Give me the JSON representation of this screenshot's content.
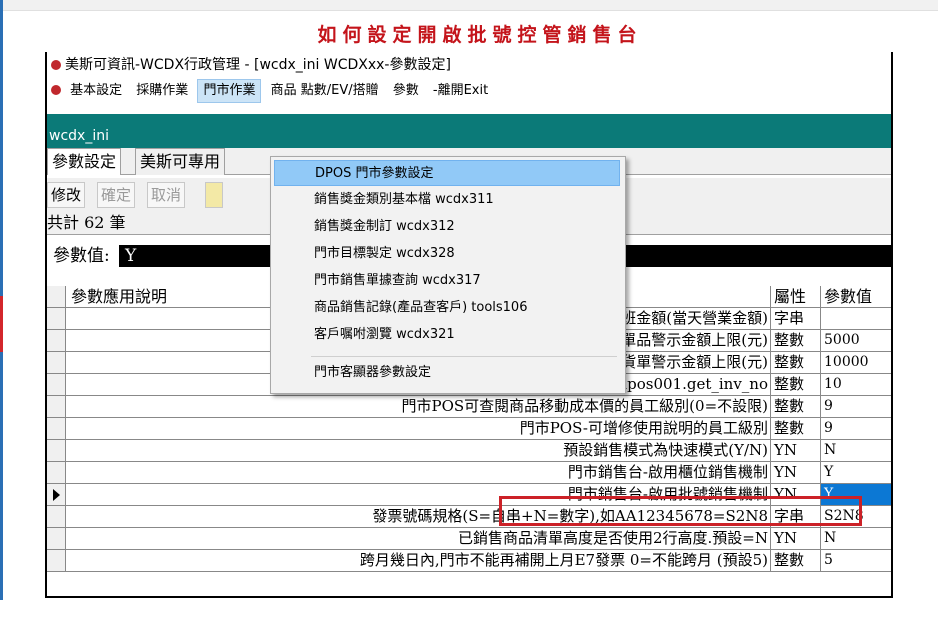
{
  "heading": "如何設定開啟批號控管銷售台",
  "window": {
    "title": "美斯可資訊-WCDX行政管理 - [wcdx_ini WCDXxx-參數設定]"
  },
  "menubar": {
    "items": [
      "基本設定",
      "採購作業",
      "門市作業",
      "商品 點數/EV/搭贈",
      "參數",
      "-離開Exit"
    ],
    "open": "門市作業"
  },
  "dropdown": {
    "items": [
      "DPOS 門市參數設定",
      "銷售獎金類別基本檔 wcdx311",
      "銷售獎金制訂 wcdx312",
      "門市目標製定 wcdx328",
      "門市銷售單據查詢 wcdx317",
      "商品銷售記錄(產品查客戶) tools106",
      "客戶嘱咐瀏覽 wcdx321",
      "門市客顯器參數設定"
    ],
    "highlighted": "DPOS 門市參數設定"
  },
  "form": {
    "caption": "wcdx_ini",
    "tabs": [
      "參數設定",
      "美斯可專用"
    ],
    "toolbar": [
      "修改",
      "確定",
      "取消"
    ],
    "toolbar_icon": "filter-icon",
    "count": "共計 62 筆",
    "param_label": "參數值:",
    "param_value": "Y"
  },
  "grid": {
    "headers": [
      "參數應用說明",
      "屬性",
      "參數值"
    ],
    "rows": [
      {
        "desc": "交班金額(當天營業金額)",
        "type": "字串",
        "value": ""
      },
      {
        "desc": "門市單品警示金額上限(元)",
        "type": "整數",
        "value": "5000"
      },
      {
        "desc": "門市銷貨單警示金額上限(元)",
        "type": "整數",
        "value": "10000"
      },
      {
        "desc": "發票號碼長度(自串+數字,如2+8) dpos001.get_inv_no",
        "type": "整數",
        "value": "10"
      },
      {
        "desc": "門市POS可查閱商品移動成本價的員工級別(0=不設限)",
        "type": "整數",
        "value": "9"
      },
      {
        "desc": "門市POS-可增修使用說明的員工級別",
        "type": "整數",
        "value": "9"
      },
      {
        "desc": "預設銷售模式為快速模式(Y/N)",
        "type": "YN",
        "value": "N"
      },
      {
        "desc": "門市銷售台-啟用櫃位銷售機制",
        "type": "YN",
        "value": "Y"
      },
      {
        "desc": "門市銷售台-啟用批號銷售機制",
        "type": "YN",
        "value": "Y"
      },
      {
        "desc": "發票號碼規格(S=自串+N=數字),如AA12345678=S2N8",
        "type": "字串",
        "value": "S2N8"
      },
      {
        "desc": "已銷售商品清單高度是否使用2行高度.預設=N",
        "type": "YN",
        "value": "N"
      },
      {
        "desc": "跨月幾日內,門市不能再補開上月E7發票 0=不能跨月 (預設5)",
        "type": "整數",
        "value": "5"
      }
    ],
    "selected_row": 8
  },
  "colors": {
    "heading": "#c4141b",
    "caption_bar": "#0b7a78",
    "selection": "#0c78d4",
    "menu_highlight": "#91c9f7",
    "callout_box": "#cc2127"
  }
}
